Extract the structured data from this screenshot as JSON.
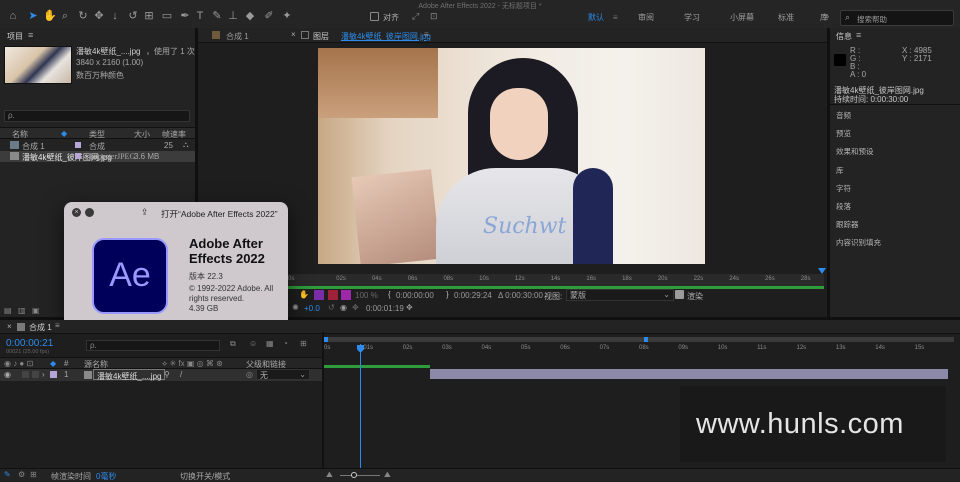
{
  "app": {
    "title": "Adobe After Effects 2022 - 无标题项目 *"
  },
  "toolbar": {
    "snap_label": "对齐",
    "tools": [
      "home-icon",
      "selection-tool-icon",
      "hand-tool-icon",
      "zoom-tool-icon",
      "orbit-camera-icon",
      "pan-camera-icon",
      "dolly-camera-icon",
      "rotation-tool-icon",
      "anchor-tool-icon",
      "mask-tool-icon",
      "pen-tool-icon",
      "type-tool-icon",
      "brush-tool-icon",
      "clone-stamp-icon",
      "eraser-tool-icon",
      "roto-brush-icon",
      "puppet-pin-icon"
    ]
  },
  "workspaces": {
    "items": [
      "默认",
      "审阅",
      "学习",
      "小屏幕",
      "标准",
      "库"
    ],
    "active": "默认",
    "more": "»",
    "search_placeholder": "搜索帮助"
  },
  "project": {
    "title": "项目",
    "menu": "≡",
    "asset_name": "潘敏4k壁纸_....jpg",
    "asset_used": "，使用了 1 次",
    "asset_dims": "3840 x 2160 (1.00)",
    "asset_color": "数百万种颜色",
    "columns": {
      "name": "名称",
      "type": "类型",
      "size": "大小",
      "fps": "帧速率"
    },
    "rows": [
      {
        "name": "合成 1",
        "type": "合成",
        "size": "",
        "fps": "25"
      },
      {
        "name": "潘敏4k壁纸_彼岸图网.jpg",
        "type": "ImporterJPEG",
        "size": "3.6 MB",
        "fps": ""
      }
    ]
  },
  "composition_tab": {
    "label": "合成 1",
    "menu": "≡"
  },
  "footage_tab": {
    "label": "图层",
    "name": "潘敏4k壁纸_彼岸图网.jpg",
    "menu": "≡",
    "close": "×"
  },
  "viewer": {
    "ruler_ticks": [
      "0s",
      "02s",
      "04s",
      "06s",
      "08s",
      "10s",
      "12s",
      "14s",
      "16s",
      "18s",
      "20s",
      "22s",
      "24s",
      "26s",
      "28s"
    ],
    "zoom": "100 %",
    "start_time": "0:00:00:00",
    "end_time": "0:00:29:24",
    "duration": "Δ 0:00:30:00",
    "view_label": "视图:",
    "view_value": "蒙版",
    "render_label": "渲染",
    "offset": "+0.0",
    "time_display": "0:00:01:19"
  },
  "info": {
    "title": "信息",
    "menu": "≡",
    "r": "R :",
    "g": "G :",
    "b": "B :",
    "a": "A : 0",
    "x": "X : 4985",
    "y": "Y : 2171",
    "file": "潘敏4k壁纸_彼岸图网.jpg",
    "duration": "持续时间: 0:00:30:00"
  },
  "right_panels": [
    "音频",
    "预览",
    "效果和预设",
    "库",
    "字符",
    "段落",
    "跟踪器",
    "内容识别填充"
  ],
  "about": {
    "title": "打开“Adobe After Effects 2022”",
    "logo": "Ae",
    "product": "Adobe After Effects 2022",
    "version": "版本 22.3",
    "copyright": "© 1992-2022 Adobe. All rights reserved.",
    "size": "4.39 GB"
  },
  "timeline": {
    "comp_tab": "合成 1",
    "timecode": "0:00:00:21",
    "timecode_sub": "00021 (25.00 fps)",
    "search_placeholder": "ρ.",
    "col_source": "源名称",
    "col_parent": "父级和链接",
    "layer_num": "1",
    "layer_name": "潘敏4k壁纸_....jpg",
    "parent_value": "无",
    "ruler": [
      "0s",
      "01s",
      "02s",
      "03s",
      "04s",
      "05s",
      "06s",
      "07s",
      "08s",
      "09s",
      "10s",
      "11s",
      "12s",
      "13s",
      "14s",
      "15s"
    ],
    "footer_render_label": "帧渲染时间",
    "footer_render_value": "0毫秒",
    "footer_toggle": "切换开关/模式"
  },
  "watermark": "www.hunls.com",
  "colors": {
    "accent": "#2d8ceb",
    "ae_purple": "#9999ff",
    "ae_bg": "#00005b",
    "layer_bar": "#8b88a8",
    "work_area": "#2e9b3c"
  }
}
